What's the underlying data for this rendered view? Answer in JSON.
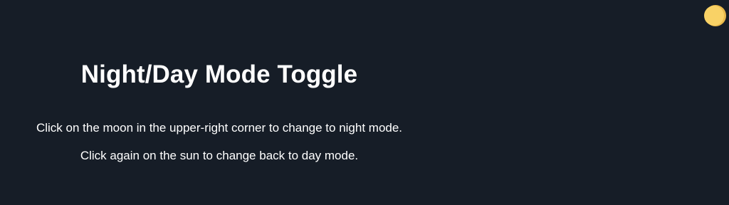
{
  "page": {
    "title": "Night/Day Mode Toggle",
    "instruction_night": "Click on the moon in the upper-right corner to change to night mode.",
    "instruction_day": "Click again on the sun to change back to day mode."
  },
  "toggle": {
    "icon": "moon-icon",
    "state": "night"
  },
  "colors": {
    "background": "#161d27",
    "text": "#ffffff",
    "sun": "#f9d266",
    "sun_shade": "#e9b94a"
  }
}
